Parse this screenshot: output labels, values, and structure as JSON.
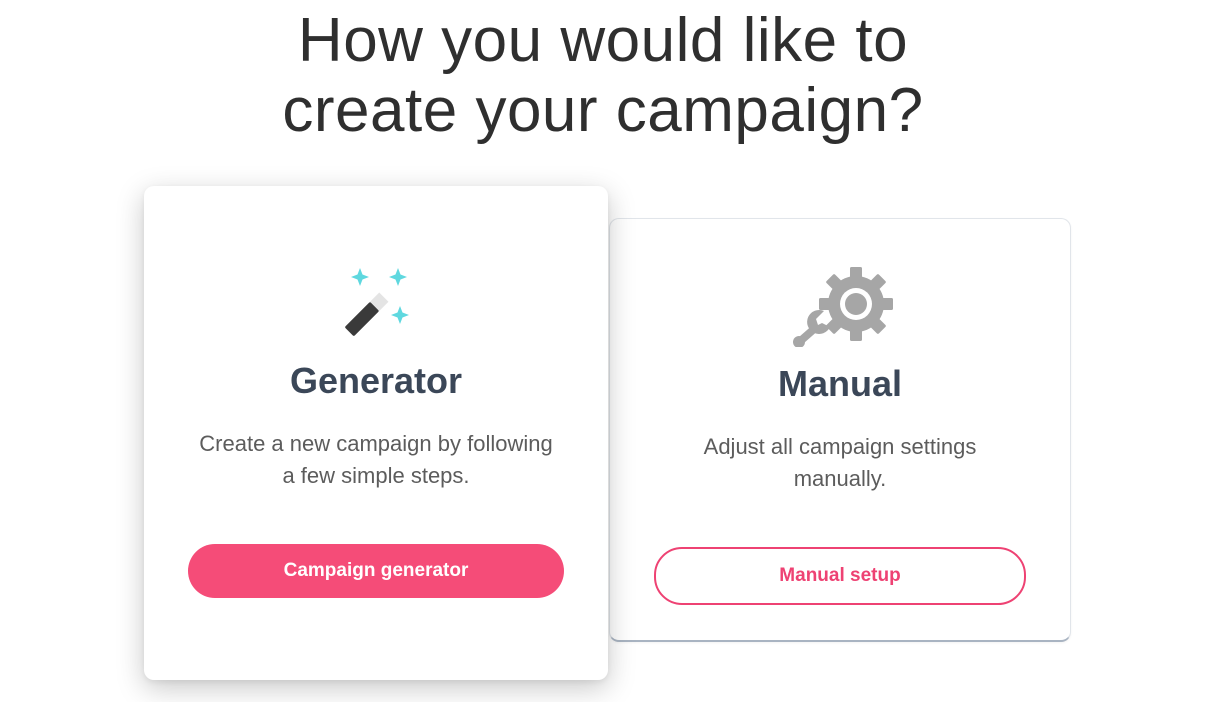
{
  "page": {
    "heading_line1": "How you would like to",
    "heading_line2": "create your campaign?"
  },
  "options": {
    "generator": {
      "icon": "magic-wand-icon",
      "title": "Generator",
      "description": "Create a new campaign by following a few simple steps.",
      "button_label": "Campaign generator"
    },
    "manual": {
      "icon": "wrench-gear-icon",
      "title": "Manual",
      "description": "Adjust all campaign settings manually.",
      "button_label": "Manual setup"
    }
  },
  "colors": {
    "accent": "#f54c78",
    "sparkle": "#5fd8df",
    "heading": "#3b4758",
    "gear": "#a6a6a6"
  }
}
